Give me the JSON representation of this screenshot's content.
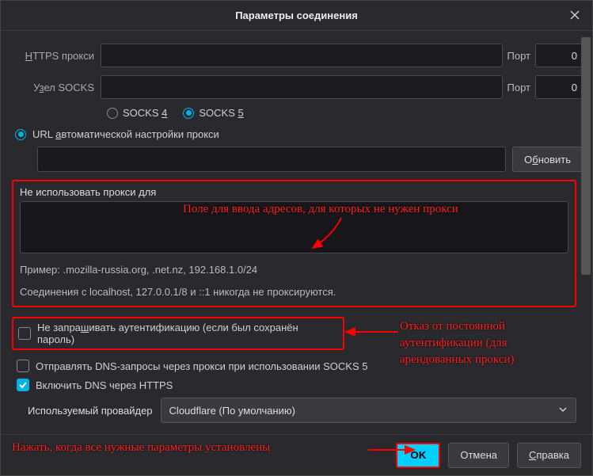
{
  "title": "Параметры соединения",
  "https": {
    "label": "HTTPS прокси",
    "value": "",
    "port_label": "Порт",
    "port": "0"
  },
  "socks": {
    "label": "Узел SOCKS",
    "value": "",
    "port_label": "Порт",
    "port": "0"
  },
  "socks_version": {
    "v4": "SOCKS 4",
    "v5": "SOCKS 5",
    "selected": "v5"
  },
  "auto_url": {
    "label": "URL автоматической настройки прокси",
    "value": "",
    "refresh": "Обновить"
  },
  "no_proxy": {
    "label": "Не использовать прокси для",
    "value": "",
    "example": "Пример: .mozilla-russia.org, .net.nz, 192.168.1.0/24",
    "note": "Соединения с localhost, 127.0.0.1/8 и ::1 никогда не проксируются."
  },
  "cb_no_auth": "Не запрашивать аутентификацию (если был сохранён пароль)",
  "cb_dns_socks": "Отправлять DNS-запросы через прокси при использовании SOCKS 5",
  "cb_doh": "Включить DNS через HTTPS",
  "provider": {
    "label": "Используемый провайдер",
    "value": "Cloudflare (По умолчанию)"
  },
  "buttons": {
    "ok": "OK",
    "cancel": "Отмена",
    "help": "Справка"
  },
  "annotations": {
    "field": "Поле для ввода адресов, для которых не нужен прокси",
    "auth": "Отказ от постоянной аутентификации (для арендованных прокси)",
    "ok": "Нажать, когда все нужные параметры установлены"
  }
}
